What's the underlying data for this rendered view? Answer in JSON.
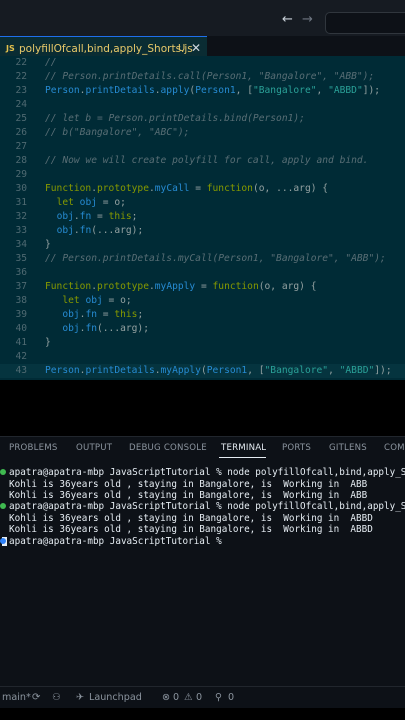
{
  "tab": {
    "icon": "JS",
    "filename": "polyfillOfcall,bind,apply_Shorts.js",
    "modified": "U",
    "close": "✕"
  },
  "nav": {
    "back": "←",
    "forward": "→"
  },
  "editor": {
    "lines": [
      {
        "n": "22",
        "tokens": [
          [
            "c-com",
            "//"
          ]
        ]
      },
      {
        "n": "22",
        "tokens": [
          [
            "c-com",
            "// Person.printDetails.call(Person1, \"Bangalore\", \"ABB\");"
          ]
        ]
      },
      {
        "n": "23",
        "tokens": [
          [
            "c-fn",
            "Person"
          ],
          [
            "c-pl",
            "."
          ],
          [
            "c-fn",
            "printDetails"
          ],
          [
            "c-pl",
            "."
          ],
          [
            "c-fn",
            "apply"
          ],
          [
            "c-pl",
            "("
          ],
          [
            "c-fn",
            "Person1"
          ],
          [
            "c-pl",
            ", ["
          ],
          [
            "c-str",
            "\"Bangalore\""
          ],
          [
            "c-pl",
            ", "
          ],
          [
            "c-str",
            "\"ABBD\""
          ],
          [
            "c-pl",
            "]);"
          ]
        ]
      },
      {
        "n": "24",
        "tokens": []
      },
      {
        "n": "25",
        "tokens": [
          [
            "c-com",
            "// let b = Person.printDetails.bind(Person1);"
          ]
        ]
      },
      {
        "n": "26",
        "tokens": [
          [
            "c-com",
            "// b(\"Bangalore\", \"ABC\");"
          ]
        ]
      },
      {
        "n": "27",
        "tokens": []
      },
      {
        "n": "28",
        "tokens": [
          [
            "c-com",
            "// Now we will create polyfill for call, apply and bind."
          ]
        ]
      },
      {
        "n": "29",
        "tokens": []
      },
      {
        "n": "30",
        "tokens": [
          [
            "c-kw",
            "Function"
          ],
          [
            "c-pl",
            "."
          ],
          [
            "c-kw",
            "prototype"
          ],
          [
            "c-pl",
            "."
          ],
          [
            "c-fn",
            "myCall"
          ],
          [
            "c-pl",
            " = "
          ],
          [
            "c-kw",
            "function"
          ],
          [
            "c-pl",
            "(o, ...arg) {"
          ]
        ]
      },
      {
        "n": "31",
        "tokens": [
          [
            "c-pl",
            "  "
          ],
          [
            "c-kw",
            "let"
          ],
          [
            "c-pl",
            " "
          ],
          [
            "c-fn",
            "obj"
          ],
          [
            "c-pl",
            " = o;"
          ]
        ]
      },
      {
        "n": "32",
        "tokens": [
          [
            "c-pl",
            "  "
          ],
          [
            "c-fn",
            "obj"
          ],
          [
            "c-pl",
            "."
          ],
          [
            "c-fn",
            "fn"
          ],
          [
            "c-pl",
            " = "
          ],
          [
            "c-kw",
            "this"
          ],
          [
            "c-pl",
            ";"
          ]
        ]
      },
      {
        "n": "33",
        "tokens": [
          [
            "c-pl",
            "  "
          ],
          [
            "c-fn",
            "obj"
          ],
          [
            "c-pl",
            "."
          ],
          [
            "c-fn",
            "fn"
          ],
          [
            "c-pl",
            "(...arg);"
          ]
        ]
      },
      {
        "n": "34",
        "tokens": [
          [
            "c-pl",
            "}"
          ]
        ]
      },
      {
        "n": "35",
        "tokens": [
          [
            "c-com",
            "// Person.printDetails.myCall(Person1, \"Bangalore\", \"ABB\");"
          ]
        ]
      },
      {
        "n": "36",
        "tokens": []
      },
      {
        "n": "37",
        "tokens": [
          [
            "c-kw",
            "Function"
          ],
          [
            "c-pl",
            "."
          ],
          [
            "c-kw",
            "prototype"
          ],
          [
            "c-pl",
            "."
          ],
          [
            "c-fn",
            "myApply"
          ],
          [
            "c-pl",
            " = "
          ],
          [
            "c-kw",
            "function"
          ],
          [
            "c-pl",
            "(o, arg) {"
          ]
        ]
      },
      {
        "n": "38",
        "tokens": [
          [
            "c-pl",
            "   "
          ],
          [
            "c-kw",
            "let"
          ],
          [
            "c-pl",
            " "
          ],
          [
            "c-fn",
            "obj"
          ],
          [
            "c-pl",
            " = o;"
          ]
        ]
      },
      {
        "n": "39",
        "tokens": [
          [
            "c-pl",
            "   "
          ],
          [
            "c-fn",
            "obj"
          ],
          [
            "c-pl",
            "."
          ],
          [
            "c-fn",
            "fn"
          ],
          [
            "c-pl",
            " = "
          ],
          [
            "c-kw",
            "this"
          ],
          [
            "c-pl",
            ";"
          ]
        ]
      },
      {
        "n": "40",
        "tokens": [
          [
            "c-pl",
            "   "
          ],
          [
            "c-fn",
            "obj"
          ],
          [
            "c-pl",
            "."
          ],
          [
            "c-fn",
            "fn"
          ],
          [
            "c-pl",
            "(...arg);"
          ]
        ]
      },
      {
        "n": "41",
        "tokens": [
          [
            "c-pl",
            "}"
          ]
        ]
      },
      {
        "n": "42",
        "tokens": []
      },
      {
        "n": "43",
        "tokens": [
          [
            "c-fn",
            "Person"
          ],
          [
            "c-pl",
            "."
          ],
          [
            "c-fn",
            "printDetails"
          ],
          [
            "c-pl",
            "."
          ],
          [
            "c-fn",
            "myApply"
          ],
          [
            "c-pl",
            "("
          ],
          [
            "c-fn",
            "Person1"
          ],
          [
            "c-pl",
            ", ["
          ],
          [
            "c-str",
            "\"Bangalore\""
          ],
          [
            "c-pl",
            ", "
          ],
          [
            "c-str",
            "\"ABBD\""
          ],
          [
            "c-pl",
            "]);"
          ]
        ],
        "active": true
      }
    ]
  },
  "panel": {
    "tabs": [
      "PROBLEMS",
      "OUTPUT",
      "DEBUG CONSOLE",
      "TERMINAL",
      "PORTS",
      "GITLENS",
      "COM"
    ],
    "active_tab": "TERMINAL"
  },
  "terminal": {
    "lines": [
      {
        "dot": "#3fb950",
        "text": "apatra@apatra-mbp JavaScriptTutorial % node polyfillOfcall,bind,apply_Sh"
      },
      {
        "dot": "",
        "text": "Kohli is 36years old , staying in Bangalore, is  Working in  ABB"
      },
      {
        "dot": "",
        "text": "Kohli is 36years old , staying in Bangalore, is  Working in  ABB"
      },
      {
        "dot": "#3fb950",
        "text": "apatra@apatra-mbp JavaScriptTutorial % node polyfillOfcall,bind,apply_Sh"
      },
      {
        "dot": "",
        "text": "Kohli is 36years old , staying in Bangalore, is  Working in  ABBD"
      },
      {
        "dot": "",
        "text": "Kohli is 36years old , staying in Bangalore, is  Working in  ABBD"
      },
      {
        "dot": "#2f81f7",
        "text": "apatra@apatra-mbp JavaScriptTutorial % ",
        "cursor": true
      }
    ]
  },
  "status": {
    "branch": "main*",
    "sync": "⟳",
    "launchpad": "Launchpad",
    "errors": "0",
    "warnings": "0",
    "ports": "0"
  },
  "colors": {
    "accent": "#1f6feb",
    "editor_bg": "#002b36",
    "terminal_bg": "#0d1117"
  }
}
